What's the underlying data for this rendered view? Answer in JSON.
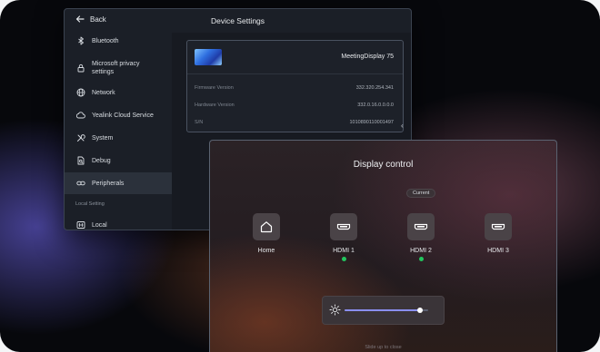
{
  "settings": {
    "back_label": "Back",
    "title": "Device Settings",
    "sidebar": {
      "items": [
        {
          "label": "Bluetooth",
          "icon": "bluetooth-icon"
        },
        {
          "label": "Microsoft privacy settings",
          "icon": "lock-icon"
        },
        {
          "label": "Network",
          "icon": "globe-icon"
        },
        {
          "label": "Yealink Cloud Service",
          "icon": "cloud-icon"
        },
        {
          "label": "System",
          "icon": "tools-icon"
        },
        {
          "label": "Debug",
          "icon": "debug-icon"
        },
        {
          "label": "Peripherals",
          "icon": "link-icon",
          "active": true
        }
      ],
      "section_label": "Local Setting",
      "local_item": {
        "label": "Local",
        "icon": "local-icon"
      }
    },
    "device": {
      "name": "MeetingDisplay 75",
      "rows": [
        {
          "label": "Firmware Version",
          "value": "332.320.254.341"
        },
        {
          "label": "Hardware Version",
          "value": "332.0.16.0.0.0.0"
        },
        {
          "label": "S/N",
          "value": "1010890110001497"
        }
      ]
    }
  },
  "display": {
    "title": "Display control",
    "current_badge": "Current",
    "sources": [
      {
        "label": "Home",
        "icon": "home-icon",
        "connected": false
      },
      {
        "label": "HDMI 1",
        "icon": "hdmi-icon",
        "connected": true
      },
      {
        "label": "HDMI 2",
        "icon": "hdmi-icon",
        "connected": true
      },
      {
        "label": "HDMI 3",
        "icon": "hdmi-icon",
        "connected": false
      }
    ],
    "brightness": 0.9,
    "swipe_hint": "Slide up to close"
  },
  "colors": {
    "accent": "#8a8ff0",
    "connected": "#22c55e"
  }
}
